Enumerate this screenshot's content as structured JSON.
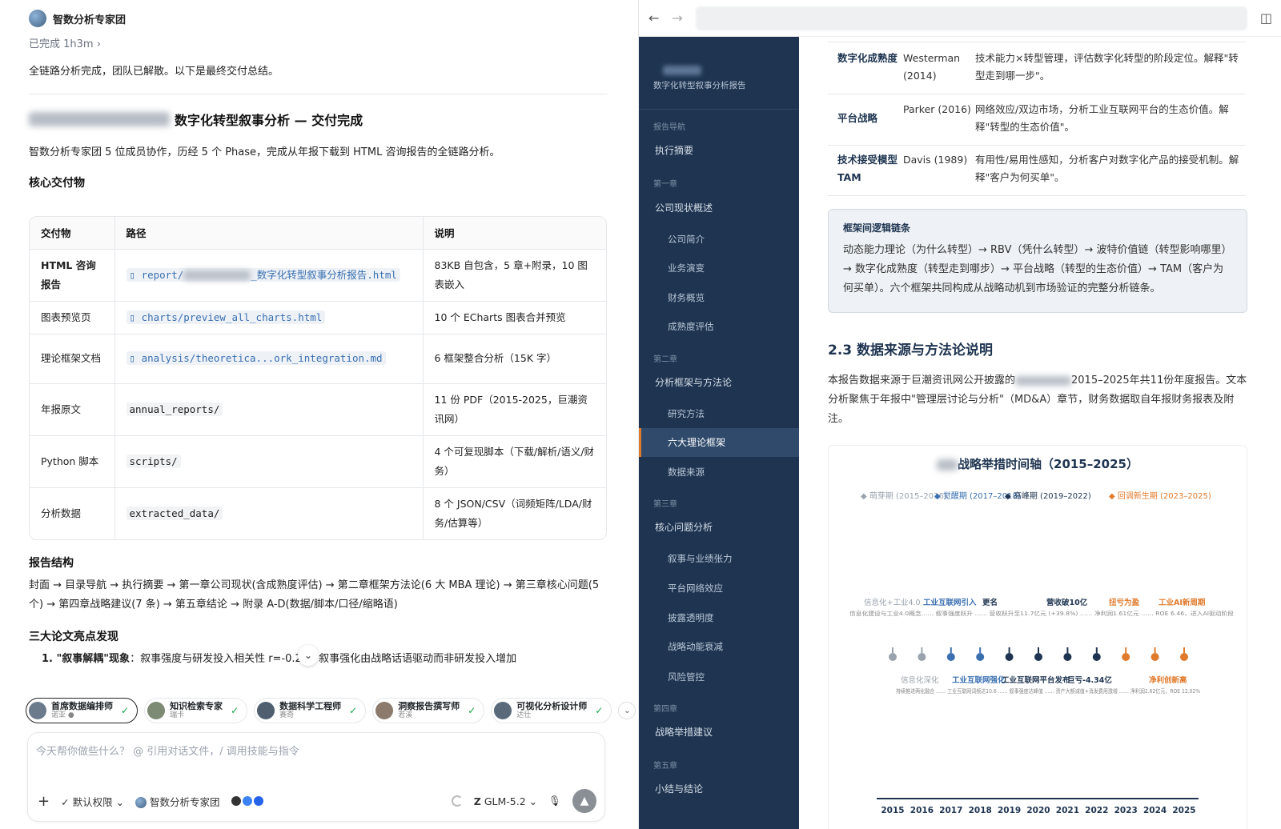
{
  "chat": {
    "team_name": "智数分析专家团",
    "status": "已完成 1h3m",
    "summary": "全链路分析完成，团队已解散。以下是最终交付总结。",
    "title_suffix": "数字化转型叙事分析 — 交付完成",
    "intro": "智数分析专家团 5 位成员协作，历经 5 个 Phase，完成从年报下载到 HTML 咨询报告的全链路分析。",
    "deliverables_heading": "核心交付物",
    "table": {
      "headers": [
        "交付物",
        "路径",
        "说明"
      ],
      "rows": [
        {
          "name": "HTML 咨询报告",
          "path_a": "report/",
          "path_b": "_数字化转型叙事分析报告.html",
          "link": true,
          "desc": "83KB 自包含，5 章+附录，10 图表嵌入"
        },
        {
          "name": "图表预览页",
          "path_a": "charts/preview_all_charts.html",
          "path_b": "",
          "link": true,
          "desc": "10 个 ECharts 图表合并预览"
        },
        {
          "name": "理论框架文档",
          "path_a": "analysis/theoretica...ork_integration.md",
          "path_b": "",
          "link": true,
          "desc": "6 框架整合分析（15K 字）"
        },
        {
          "name": "年报原文",
          "path_a": "annual_reports/",
          "path_b": "",
          "link": false,
          "desc": "11 份 PDF（2015-2025，巨潮资讯网）"
        },
        {
          "name": "Python 脚本",
          "path_a": "scripts/",
          "path_b": "",
          "link": false,
          "desc": "4 个可复现脚本（下载/解析/语义/财务）"
        },
        {
          "name": "分析数据",
          "path_a": "extracted_data/",
          "path_b": "",
          "link": false,
          "desc": "8 个 JSON/CSV（词频矩阵/LDA/财务/估算等）"
        }
      ]
    },
    "structure_heading": "报告结构",
    "structure_text": "封面 → 目录导航 → 执行摘要 → 第一章公司现状(含成熟度评估) → 第二章框架方法论(6 大 MBA 理论) → 第三章核心问题(5 个) → 第四章战略建议(7 条) → 第五章结论 → 附录 A-D(数据/脚本/口径/缩略语)",
    "findings_heading": "三大论文亮点发现",
    "finding_1_label": "1. \"叙事解耦\"现象",
    "finding_1_text": "：叙事强度与研发投入相关性 r=-0.27，叙事强化由战略话语驱动而非研发投入增加",
    "agents": [
      {
        "name": "首席数据编排师",
        "sub": "诺亚"
      },
      {
        "name": "知识检索专家",
        "sub": "瑞卡"
      },
      {
        "name": "数据科学工程师",
        "sub": "赛奇"
      },
      {
        "name": "洞察报告撰写师",
        "sub": "若溪"
      },
      {
        "name": "可视化分析设计师",
        "sub": "达仕"
      }
    ],
    "input_placeholder": "今天帮你做些什么？ @ 引用对话文件，/ 调用技能与指令",
    "toolbar": {
      "plus": "+",
      "permission": "默认权限",
      "team": "智数分析专家团",
      "model": "GLM-5.2"
    }
  },
  "report": {
    "sidebar_title": "数字化转型叙事分析报告",
    "nav": [
      {
        "type": "sec",
        "label": "报告导航"
      },
      {
        "type": "item",
        "label": "执行摘要"
      },
      {
        "type": "sec",
        "label": "第一章"
      },
      {
        "type": "item",
        "label": "公司现状概述"
      },
      {
        "type": "sub",
        "label": "公司简介"
      },
      {
        "type": "sub",
        "label": "业务演变"
      },
      {
        "type": "sub",
        "label": "财务概览"
      },
      {
        "type": "sub",
        "label": "成熟度评估"
      },
      {
        "type": "sec",
        "label": "第二章"
      },
      {
        "type": "item",
        "label": "分析框架与方法论"
      },
      {
        "type": "sub",
        "label": "研究方法"
      },
      {
        "type": "active",
        "label": "六大理论框架"
      },
      {
        "type": "sub",
        "label": "数据来源"
      },
      {
        "type": "sec",
        "label": "第三章"
      },
      {
        "type": "item",
        "label": "核心问题分析"
      },
      {
        "type": "sub",
        "label": "叙事与业绩张力"
      },
      {
        "type": "sub",
        "label": "平台网络效应"
      },
      {
        "type": "sub",
        "label": "披露透明度"
      },
      {
        "type": "sub",
        "label": "战略动能衰减"
      },
      {
        "type": "sub",
        "label": "风险管控"
      },
      {
        "type": "sec",
        "label": "第四章"
      },
      {
        "type": "item",
        "label": "战略举措建议"
      },
      {
        "type": "sec",
        "label": "第五章"
      },
      {
        "type": "item",
        "label": "小结与结论"
      }
    ],
    "frameworks": [
      {
        "name": "数字化成熟度",
        "source": "Westerman (2014)",
        "desc": "技术能力×转型管理，评估数字化转型的阶段定位。解释\"转型走到哪一步\"。"
      },
      {
        "name": "平台战略",
        "source": "Parker (2016)",
        "desc": "网络效应/双边市场，分析工业互联网平台的生态价值。解释\"转型的生态价值\"。"
      },
      {
        "name": "技术接受模型TAM",
        "source": "Davis (1989)",
        "desc": "有用性/易用性感知，分析客户对数字化产品的接受机制。解释\"客户为何买单\"。"
      }
    ],
    "box_title": "框架间逻辑链条",
    "box_text": "动态能力理论（为什么转型）→ RBV（凭什么转型）→ 波特价值链（转型影响哪里）→ 数字化成熟度（转型走到哪步）→ 平台战略（转型的生态价值）→ TAM（客户为何买单）。六个框架共同构成从战略动机到市场验证的完整分析链条。",
    "section_heading": "2.3 数据来源与方法论说明",
    "section_text_a": "本报告数据来源于巨潮资讯网公开披露的",
    "section_text_b": "2015–2025年共11份年度报告。文本分析聚焦于年报中\"管理层讨论与分析\"（MD&A）章节，财务数据取自年报财务报表及附注。",
    "chart_data": {
      "type": "timeline",
      "title": "战略举措时间轴（2015–2025）",
      "legend": [
        {
          "name": "萌芽期 (2015–2016)",
          "color": "#9aa3ad"
        },
        {
          "name": "觉醒期 (2017–2018)",
          "color": "#3a6fb0"
        },
        {
          "name": "高峰期 (2019–2022)",
          "color": "#1e3450"
        },
        {
          "name": "回调新生期 (2023–2025)",
          "color": "#e07a2c"
        }
      ],
      "years": [
        "2015",
        "2016",
        "2017",
        "2018",
        "2019",
        "2020",
        "2021",
        "2022",
        "2023",
        "2024",
        "2025"
      ],
      "phase_index": [
        0,
        0,
        1,
        1,
        2,
        2,
        2,
        2,
        3,
        3,
        3
      ],
      "top_labels": [
        {
          "text": "信息化+工业4.0",
          "phase": 0
        },
        {
          "text": "工业互联网引入",
          "phase": 1
        },
        {
          "text": "更名",
          "phase": 2
        },
        {
          "text": "营收破10亿",
          "phase": 2
        },
        {
          "text": "扭亏为盈",
          "phase": 3
        },
        {
          "text": "工业AI新周期",
          "phase": 3
        }
      ],
      "bottom_labels": [
        {
          "text": "信息化深化",
          "phase": 0
        },
        {
          "text": "工业互联网强化",
          "phase": 1
        },
        {
          "text": "工业互联网平台发布",
          "phase": 2
        },
        {
          "text": "巨亏-4.34亿",
          "phase": 2
        },
        {
          "text": "净利创新高",
          "phase": 3
        }
      ],
      "top_note": "信息化建设与工业4.0概念…… 叙事强度跃升 …… 营收跃升至11.7亿元 (+39.8%) …… 净利润1.61亿元 …… ROE 6.46，进入AI驱动阶段",
      "bottom_note": "持续推进两化融合 …… 工业互联网词频达10.6 …… 叙事强度达峰值 …… 资产大额减值+消发费用激增 …… 净利润2.62亿元，ROE 12.02%"
    }
  }
}
